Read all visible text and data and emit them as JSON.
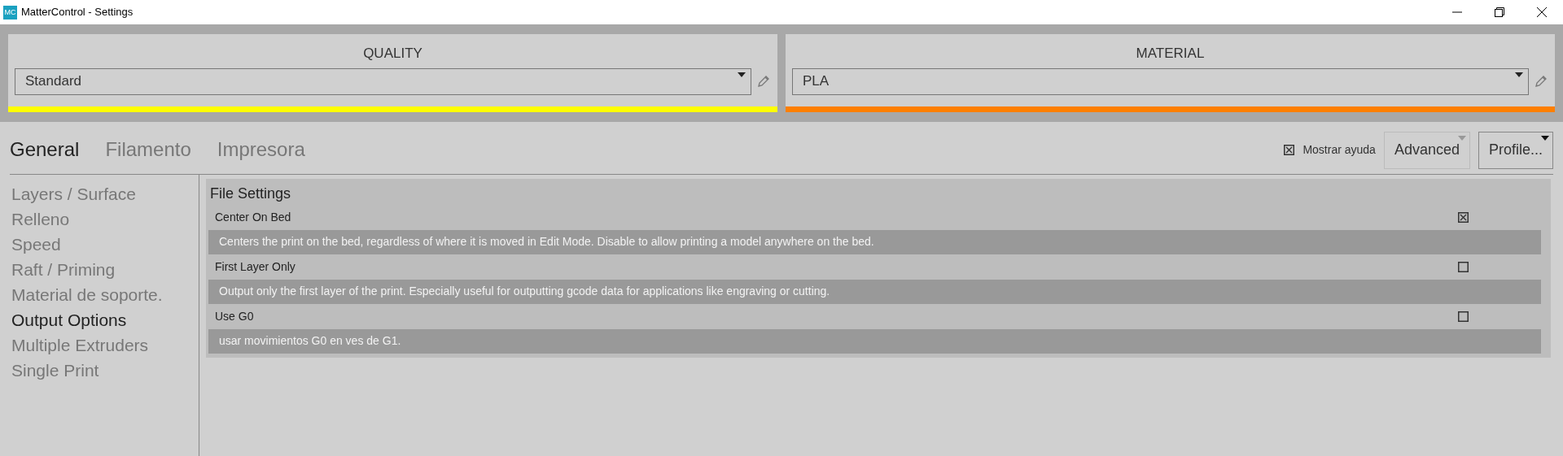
{
  "window": {
    "title": "MatterControl - Settings",
    "logo": "MC"
  },
  "presets": [
    {
      "title": "QUALITY",
      "value": "Standard",
      "color": "#ffff00"
    },
    {
      "title": "MATERIAL",
      "value": "PLA",
      "color": "#ff7f00"
    }
  ],
  "tabs": [
    {
      "label": "General",
      "selected": true
    },
    {
      "label": "Filamento",
      "selected": false
    },
    {
      "label": "Impresora",
      "selected": false
    }
  ],
  "show_help": {
    "label": "Mostrar ayuda",
    "checked": true
  },
  "buttons": [
    {
      "label": "Advanced",
      "disabled": true
    },
    {
      "label": "Profile...",
      "disabled": false
    }
  ],
  "sidebar": {
    "items": [
      {
        "label": "Layers / Surface",
        "selected": false
      },
      {
        "label": "Relleno",
        "selected": false
      },
      {
        "label": "Speed",
        "selected": false
      },
      {
        "label": "Raft / Priming",
        "selected": false
      },
      {
        "label": "Material de soporte.",
        "selected": false
      },
      {
        "label": "Output Options",
        "selected": true
      },
      {
        "label": "Multiple Extruders",
        "selected": false
      },
      {
        "label": "Single Print",
        "selected": false
      }
    ]
  },
  "section": {
    "title": "File Settings",
    "settings": [
      {
        "label": "Center On Bed",
        "checked": true,
        "help": "Centers the print on the bed, regardless of where it is moved in Edit Mode. Disable to allow printing a model anywhere on the bed."
      },
      {
        "label": "First Layer Only",
        "checked": false,
        "help": "Output only the first layer of the print. Especially useful for outputting gcode data for applications like engraving or cutting."
      },
      {
        "label": "Use G0",
        "checked": false,
        "help": "usar movimientos G0 en ves de G1."
      }
    ]
  }
}
